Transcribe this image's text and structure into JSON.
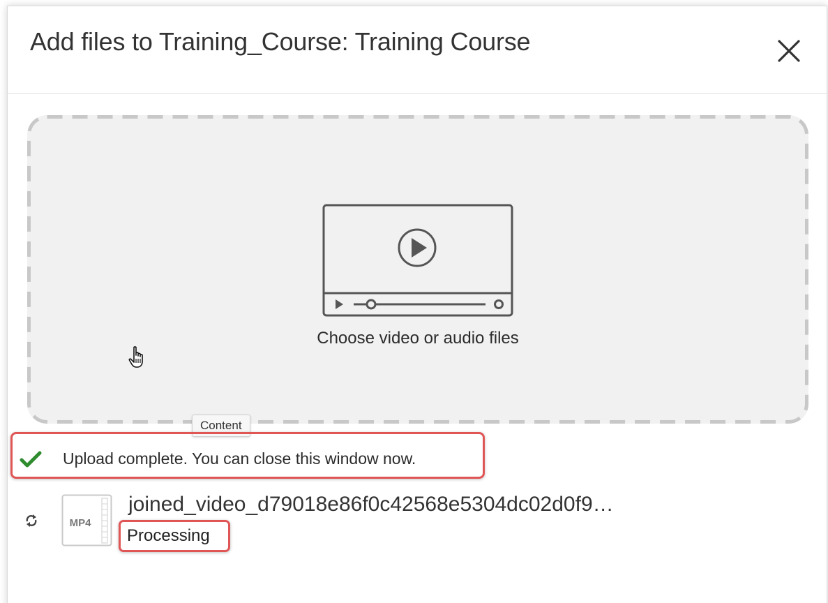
{
  "modal": {
    "title": "Add files to Training_Course: Training Course",
    "close_icon": "close-icon"
  },
  "dropzone": {
    "icon": "video-player-icon",
    "label": "Choose video or audio files",
    "tooltip": "Content"
  },
  "upload_status": {
    "icon": "checkmark-icon",
    "text": "Upload complete. You can close this window now.",
    "color": "#2e8b2e"
  },
  "file": {
    "status_icon": "refresh-icon",
    "type_label": "MP4",
    "name": "joined_video_d79018e86f0c42568e5304dc02d0f9…",
    "status": "Processing"
  },
  "colors": {
    "highlight": "#e05555",
    "dropzone_bg": "#f1f1f1",
    "dash": "#c8c8c8",
    "icon": "#555555"
  }
}
